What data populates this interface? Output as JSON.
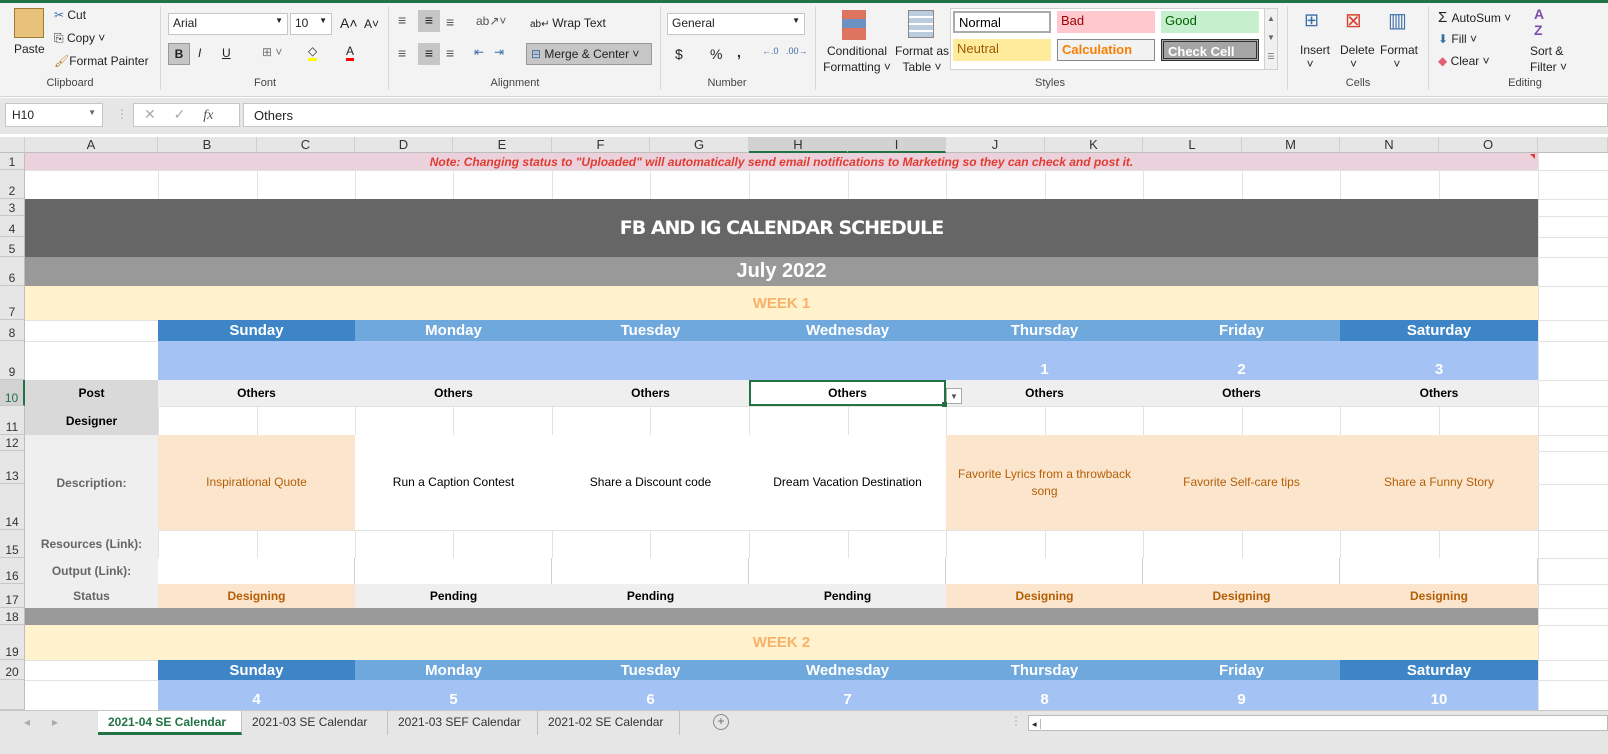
{
  "ribbon": {
    "clipboard": {
      "paste": "Paste",
      "cut": "Cut",
      "copy": "Copy",
      "format_painter": "Format Painter",
      "label": "Clipboard"
    },
    "font": {
      "name": "Arial",
      "size": "10",
      "label": "Font",
      "bold": "B",
      "italic": "I",
      "underline": "U"
    },
    "alignment": {
      "wrap_text": "Wrap Text",
      "merge_center": "Merge & Center",
      "label": "Alignment"
    },
    "number": {
      "format": "General",
      "currency": "$",
      "percent": "%",
      "comma": ",",
      "label": "Number"
    },
    "styles": {
      "conditional_formatting": [
        "Conditional",
        "Formatting"
      ],
      "format_as_table": [
        "Format as",
        "Table"
      ],
      "cells": [
        {
          "label": "Normal",
          "bg": "#ffffff",
          "fg": "#000000"
        },
        {
          "label": "Bad",
          "bg": "#ffc7ce",
          "fg": "#9c0006"
        },
        {
          "label": "Good",
          "bg": "#c6efce",
          "fg": "#006100"
        },
        {
          "label": "Neutral",
          "bg": "#ffeb9c",
          "fg": "#9c5700"
        },
        {
          "label": "Calculation",
          "bg": "#f2f2f2",
          "fg": "#fa7d00"
        },
        {
          "label": "Check Cell",
          "bg": "#a5a5a5",
          "fg": "#ffffff"
        }
      ],
      "label": "Styles"
    },
    "cells": {
      "insert": "Insert",
      "delete": "Delete",
      "format": "Format",
      "label": "Cells"
    },
    "editing": {
      "autosum": "AutoSum",
      "fill": "Fill",
      "clear": "Clear",
      "sort_filter": [
        "Sort &",
        "Filter"
      ],
      "label": "Editing"
    }
  },
  "formula_bar": {
    "name_box": "H10",
    "formula": "Others",
    "fx": "fx"
  },
  "columns": [
    "A",
    "B",
    "C",
    "D",
    "E",
    "F",
    "G",
    "H",
    "I",
    "J",
    "K",
    "L",
    "M",
    "N",
    "O"
  ],
  "rows": [
    "1",
    "2",
    "3",
    "4",
    "5",
    "6",
    "7",
    "8",
    "9",
    "10",
    "11",
    "12",
    "13",
    "14",
    "15",
    "16",
    "17",
    "18",
    "19",
    "20"
  ],
  "sheet": {
    "note": "Note: Changing status to \"Uploaded\" will automatically send email notifications to Marketing so they can check and post it.",
    "title": "FB AND IG CALENDAR SCHEDULE",
    "month": "July 2022",
    "labels": {
      "post": "Post",
      "designer": "Designer",
      "description": "Description:",
      "resources": "Resources (Link):",
      "output": "Output (Link):",
      "status": "Status"
    },
    "days": [
      "Sunday",
      "Monday",
      "Tuesday",
      "Wednesday",
      "Thursday",
      "Friday",
      "Saturday"
    ],
    "weeks": [
      {
        "label": "WEEK 1",
        "dates": [
          "",
          "",
          "",
          "",
          "1",
          "2",
          "3"
        ],
        "posts": [
          "Others",
          "Others",
          "Others",
          "Others",
          "Others",
          "Others",
          "Others"
        ],
        "descriptions": [
          "Inspirational Quote",
          "Run a Caption Contest",
          "Share a Discount code",
          "Dream Vacation Destination",
          "Favorite Lyrics from a throwback song",
          "Favorite Self-care tips",
          "Share a Funny Story"
        ],
        "statuses": [
          "Designing",
          "Pending",
          "Pending",
          "Pending",
          "Designing",
          "Designing",
          "Designing"
        ]
      },
      {
        "label": "WEEK 2",
        "dates": [
          "4",
          "5",
          "6",
          "7",
          "8",
          "9",
          "10"
        ]
      }
    ]
  },
  "sheet_tabs": [
    {
      "label": "2021-04 SE Calendar",
      "active": true
    },
    {
      "label": "2021-03 SE Calendar"
    },
    {
      "label": "2021-03 SEF Calendar"
    },
    {
      "label": "2021-02 SE Calendar"
    }
  ],
  "colors": {
    "accent": "#217346",
    "title_bg": "#666666",
    "month_bg": "#999999",
    "week_bg": "#fff2cc",
    "week_fg": "#f6b26b",
    "day_dark": "#3d85c6",
    "day_light": "#6fa8dc",
    "date_bg": "#a4c2f4",
    "designing_bg": "#fce5cd",
    "designing_fg": "#b45f06",
    "note_bg": "#ead1dc",
    "note_fg": "#e03c31"
  }
}
